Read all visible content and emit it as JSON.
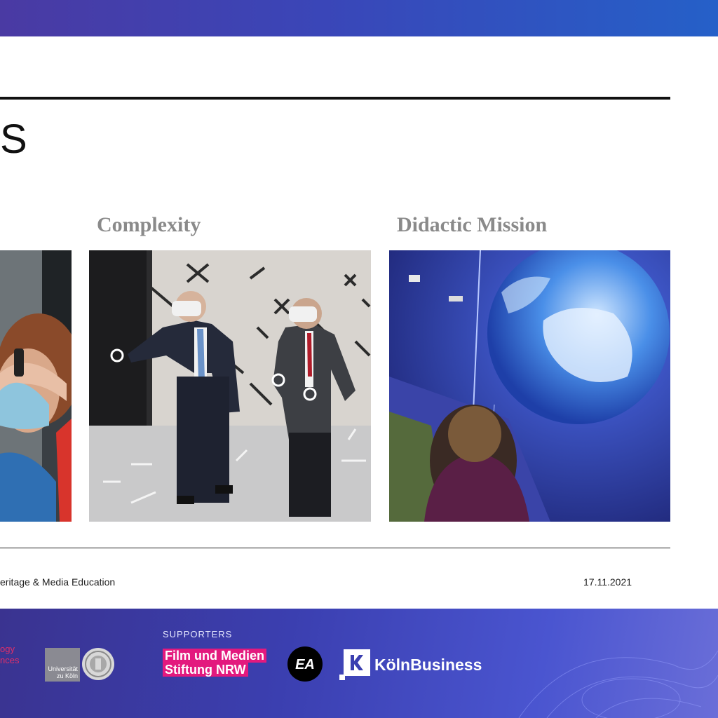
{
  "slide": {
    "title": "S",
    "columns": [
      {
        "label": ""
      },
      {
        "label": "Complexity"
      },
      {
        "label": "Didactic Mission"
      }
    ],
    "footer": {
      "left": "eritage & Media Education",
      "date": "17.11.2021"
    }
  },
  "banner": {
    "supporters_label": "SUPPORTERS",
    "partial_logo_line1": "ogy",
    "partial_logo_line2": "nces",
    "uni_logo_line1": "Universität",
    "uni_logo_line2": "zu Köln",
    "film_line1": "Film und Medien",
    "film_line2": "Stiftung NRW",
    "ea_text": "EA",
    "koeln_text": "KölnBusiness"
  },
  "colors": {
    "accent_pink": "#e3197e",
    "label_gray": "#8a8a8a",
    "banner_blue": "#3b3fb0"
  },
  "icons": [
    "ea-logo-icon",
    "koelnbusiness-k-icon",
    "university-seal-icon"
  ]
}
